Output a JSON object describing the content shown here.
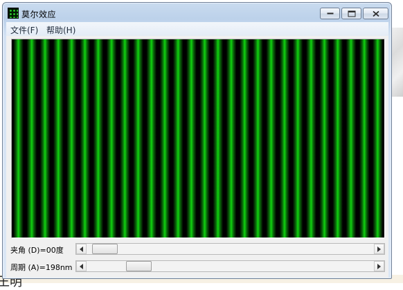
{
  "window": {
    "title": "莫尔效应",
    "icon": "moire-app-icon"
  },
  "menu": {
    "file": "文件(F)",
    "help": "帮助(H)"
  },
  "pattern": {
    "stripe_color": "#10d410",
    "background_color": "#000000",
    "stripe_count": 28
  },
  "controls": {
    "angle": {
      "label": "夹角 (D)=00度",
      "value_fraction": 0.02
    },
    "period": {
      "label": "周期 (A)=198nm",
      "value_fraction": 0.15
    }
  },
  "desktop": {
    "bottom_text": "王明"
  }
}
